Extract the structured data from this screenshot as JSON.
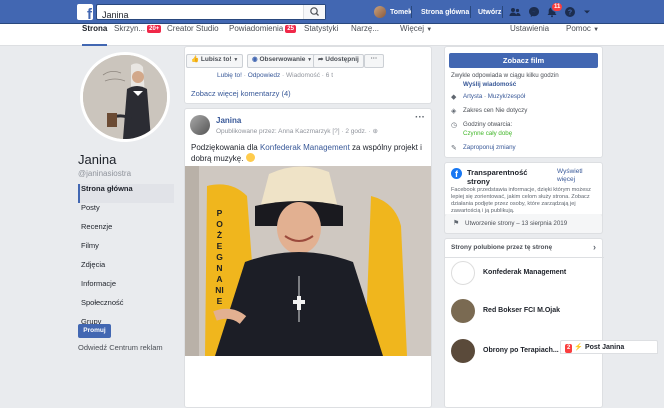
{
  "topbar": {
    "logo": "f",
    "search_value": "Janina",
    "user_name": "Tomek",
    "home_label": "Strona główna",
    "create_label": "Utwórz",
    "notif_count": "11",
    "brand_color": "#4267b2"
  },
  "pagenav": {
    "items": [
      {
        "label": "Strona"
      },
      {
        "label": "Skrzyn...",
        "badge": "20+"
      },
      {
        "label": "Creator Studio"
      },
      {
        "label": "Powiadomienia",
        "badge": "25"
      },
      {
        "label": "Statystyki"
      },
      {
        "label": "Narzę..."
      },
      {
        "label": "Więcej"
      }
    ],
    "settings_label": "Ustawienia",
    "help_label": "Pomoc"
  },
  "left": {
    "name": "Janina",
    "handle": "@janinasiostra",
    "nav": [
      "Strona główna",
      "Posty",
      "Recenzje",
      "Filmy",
      "Zdjęcia",
      "Informacje",
      "Społeczność",
      "Grupy"
    ],
    "promote_label": "Promuj",
    "ads_label": "Odwiedź Centrum reklam"
  },
  "actions": {
    "like": "Lubisz to!",
    "follow": "Obserwowanie",
    "share": "Udostępnij",
    "more": "···"
  },
  "comment": {
    "like": "Lubię to!",
    "reply": "Odpowiedz",
    "message": "Wiadomość",
    "time": "6 t",
    "more_comments": "Zobacz więcej komentarzy (4)"
  },
  "post": {
    "author": "Janina",
    "meta": "Opublikowane przez: Anna Kaczmarzyk [?] · 2 godz. ·",
    "text_before": "Podziękowania dla",
    "link": "Konfederak Management",
    "text_after": "za wspólny projekt i dobrą muzykę.",
    "image_letters": "POŻEGNANIE"
  },
  "right": {
    "film_button": "Zobacz film",
    "response_text": "Zwykle odpowiada w ciągu kilku godzin",
    "send_message": "Wyślij wiadomość",
    "category_a": "Artysta",
    "category_b": "Muzyk/zespół",
    "price": "Zakres cen Nie dotyczy",
    "hours_label": "Godziny otwarcia:",
    "hours_value": "Czynne cały dobę",
    "suggest_edits": "Zaproponuj zmiany",
    "transparency_title": "Transparentność strony",
    "see_all": "Wyświetl więcej",
    "transparency_text": "Facebook przedstawia informacje, dzięki którym możesz lepiej się zorientować, jakim celom służy strona. Zobacz działania podjęte przez osoby, które zarządzają jej zawartością i ją publikują.",
    "created": "Utworzenie strony – 13 sierpnia 2019",
    "liked_title": "Strony polubione przez tę stronę",
    "liked": [
      "Konfederak Management",
      "Red Bokser FCI M.Ojak",
      "Obrony po Terapiach..."
    ]
  },
  "chat": {
    "badge": "2",
    "label": "Post Janina"
  }
}
